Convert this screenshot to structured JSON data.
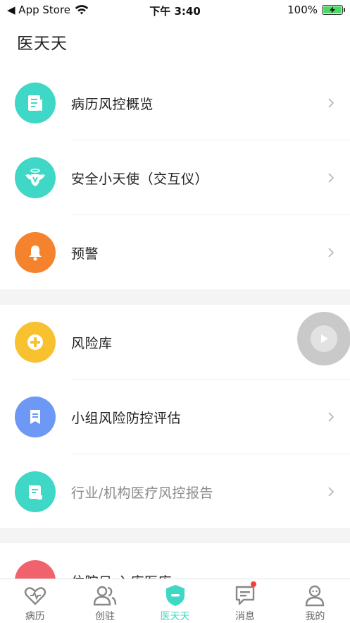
{
  "status_bar": {
    "back_app": "◀ App Store",
    "time": "下午 3:40",
    "battery": "100%"
  },
  "header": {
    "title": "医天天"
  },
  "groups": [
    {
      "items": [
        {
          "label": "病历风控概览",
          "icon": "document-icon",
          "color": "#3fd7c5"
        },
        {
          "label": "安全小天使（交互仪）",
          "icon": "angel-badge-icon",
          "color": "#3fd7c5"
        },
        {
          "label": "预警",
          "icon": "bell-icon",
          "color": "#f5822d"
        }
      ]
    },
    {
      "items": [
        {
          "label": "风险库",
          "icon": "plus-circle-icon",
          "color": "#f7c12f"
        },
        {
          "label": "小组风险防控评估",
          "icon": "bookmark-icon",
          "color": "#6d98f5"
        },
        {
          "label": "行业/机构医疗风控报告",
          "icon": "scroll-icon",
          "color": "#3fd7c5",
          "muted": true
        }
      ]
    },
    {
      "items": [
        {
          "label": "住院日 入库医库",
          "icon": "partial-icon",
          "color": "#f1636c"
        }
      ]
    }
  ],
  "tabbar": {
    "tabs": [
      {
        "label": "病历",
        "icon": "heart-icon",
        "active": false
      },
      {
        "label": "创驻",
        "icon": "users-icon",
        "active": false
      },
      {
        "label": "医天天",
        "icon": "shield-minus-icon",
        "active": true
      },
      {
        "label": "消息",
        "icon": "message-icon",
        "active": false,
        "badge": true
      },
      {
        "label": "我的",
        "icon": "person-icon",
        "active": false
      }
    ]
  }
}
